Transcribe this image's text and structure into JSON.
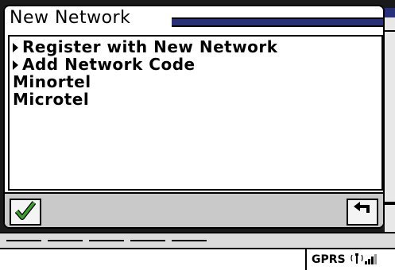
{
  "dialog": {
    "title": "New Network",
    "items": [
      {
        "label": "Register with New Network",
        "has_arrow": true
      },
      {
        "label": "Add Network Code",
        "has_arrow": true
      },
      {
        "label": "Minortel",
        "has_arrow": false
      },
      {
        "label": "Microtel",
        "has_arrow": false
      }
    ],
    "ok_icon": "checkmark-icon",
    "back_icon": "return-arrow-icon"
  },
  "status": {
    "network_type": "GPRS",
    "signal_icon": "signal-strength-icon"
  },
  "colors": {
    "title_accent": "#28307a",
    "checkmark": "#3aa02a",
    "bar_background": "#c9c9c9"
  }
}
